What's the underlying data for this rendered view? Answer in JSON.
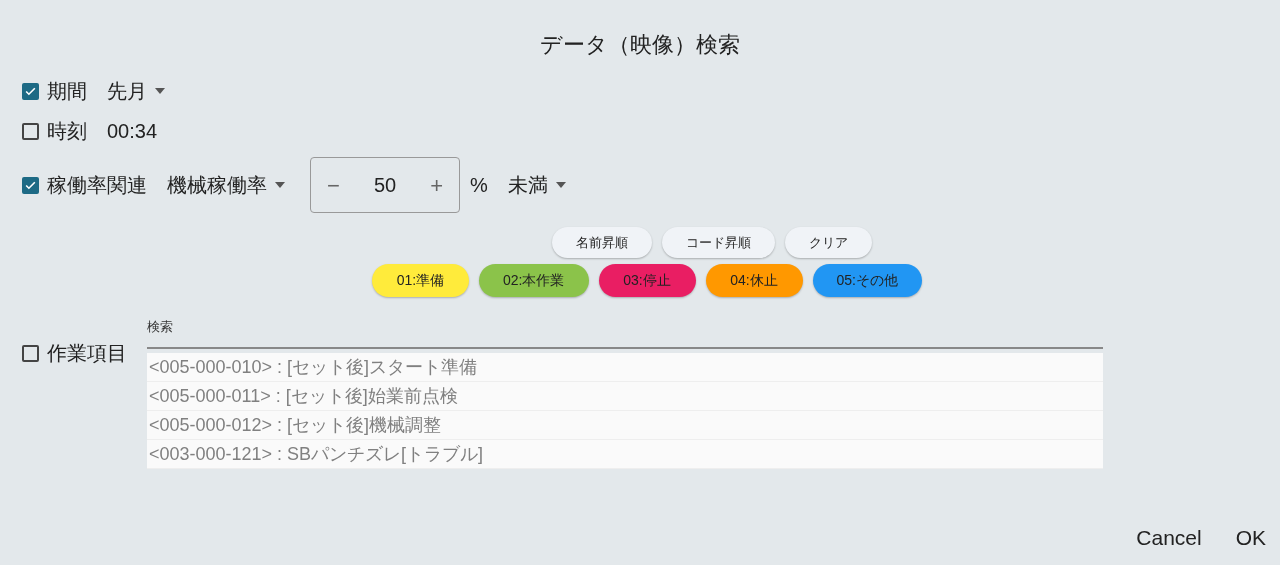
{
  "title": "データ（映像）検索",
  "period": {
    "label": "期間",
    "checked": true,
    "value": "先月"
  },
  "time": {
    "label": "時刻",
    "checked": false,
    "value": "00:34"
  },
  "rate": {
    "label": "稼働率関連",
    "checked": true,
    "metric": "機械稼働率",
    "minus": "−",
    "value": "50",
    "plus": "+",
    "unit": "%",
    "condition": "未満"
  },
  "sort_buttons": [
    "名前昇順",
    "コード昇順",
    "クリア"
  ],
  "categories": [
    {
      "label": "01:準備",
      "color": "#ffeb3b"
    },
    {
      "label": "02:本作業",
      "color": "#8bc34a"
    },
    {
      "label": "03:停止",
      "color": "#e91e63"
    },
    {
      "label": "04:休止",
      "color": "#ff9800"
    },
    {
      "label": "05:その他",
      "color": "#2196f3"
    }
  ],
  "work_items": {
    "label": "作業項目",
    "checked": false,
    "search_label": "検索",
    "items": [
      "<005-000-010> : [セット後]スタート準備",
      "<005-000-011> : [セット後]始業前点検",
      "<005-000-012> : [セット後]機械調整",
      "<003-000-121> : SBパンチズレ[トラブル]"
    ]
  },
  "buttons": [
    "Cancel",
    "OK"
  ]
}
